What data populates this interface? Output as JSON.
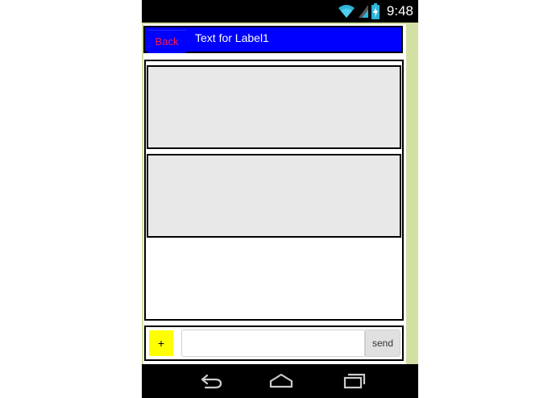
{
  "status_bar": {
    "time": "9:48",
    "icons": [
      "wifi-icon",
      "signal-icon",
      "battery-charging-icon"
    ]
  },
  "title_bar": {
    "back_label": "Back",
    "label": "Text for Label1",
    "background_color": "#0000ff",
    "back_text_color": "#ff1a4a"
  },
  "list": {
    "items": [
      {
        "text": ""
      },
      {
        "text": ""
      }
    ]
  },
  "input_row": {
    "add_label": "+",
    "message_value": "",
    "send_label": "send",
    "add_button_color": "#ffff00"
  },
  "nav_bar": {
    "buttons": [
      "back-nav-icon",
      "home-icon",
      "recent-apps-icon"
    ]
  },
  "colors": {
    "frame": "#d3e0a4",
    "item_background": "#e8e8e8"
  }
}
